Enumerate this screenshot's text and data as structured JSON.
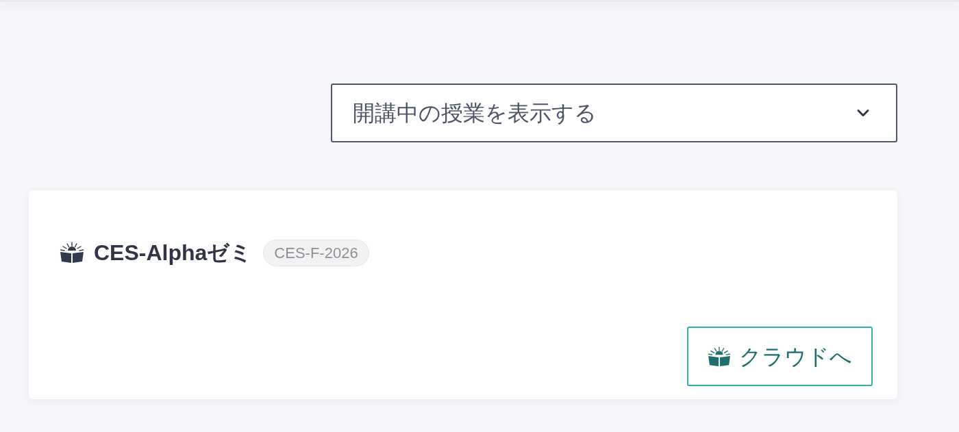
{
  "filter_select": {
    "value": "開講中の授業を表示する"
  },
  "courses": [
    {
      "title": "CES-Alphaゼミ",
      "code": "CES-F-2026",
      "action": "クラウドへ"
    }
  ]
}
